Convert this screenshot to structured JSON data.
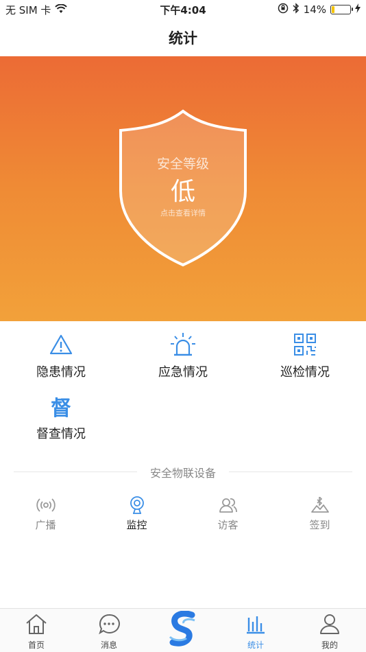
{
  "status_bar": {
    "carrier": "无 SIM 卡",
    "time": "下午4:04",
    "battery_percent": "14%",
    "battery_level": 0.14
  },
  "nav": {
    "title": "统计"
  },
  "hero": {
    "label": "安全等级",
    "level": "低",
    "hint": "点击查看详情",
    "gradient_top": "#ec6b35",
    "gradient_bottom": "#f2a13a"
  },
  "functions": [
    {
      "label": "隐患情况",
      "icon": "warning-triangle-icon"
    },
    {
      "label": "应急情况",
      "icon": "alarm-light-icon"
    },
    {
      "label": "巡检情况",
      "icon": "qr-code-icon"
    },
    {
      "label": "督查情况",
      "icon": "supervise-glyph-icon",
      "glyph": "督"
    }
  ],
  "section": {
    "title": "安全物联设备"
  },
  "devices": [
    {
      "label": "广播",
      "icon": "broadcast-icon",
      "active": false
    },
    {
      "label": "监控",
      "icon": "camera-icon",
      "active": true
    },
    {
      "label": "访客",
      "icon": "visitor-icon",
      "active": false
    },
    {
      "label": "签到",
      "icon": "bluetooth-checkin-icon",
      "active": false
    }
  ],
  "tabs": [
    {
      "label": "首页",
      "icon": "home-icon"
    },
    {
      "label": "消息",
      "icon": "message-icon"
    },
    {
      "label": "",
      "icon": "logo-icon"
    },
    {
      "label": "统计",
      "icon": "stats-icon",
      "active": true
    },
    {
      "label": "我的",
      "icon": "user-icon"
    }
  ],
  "colors": {
    "accent": "#3a8ee6",
    "icon_gray": "#9a9a9a",
    "inactive_text": "#888888"
  }
}
